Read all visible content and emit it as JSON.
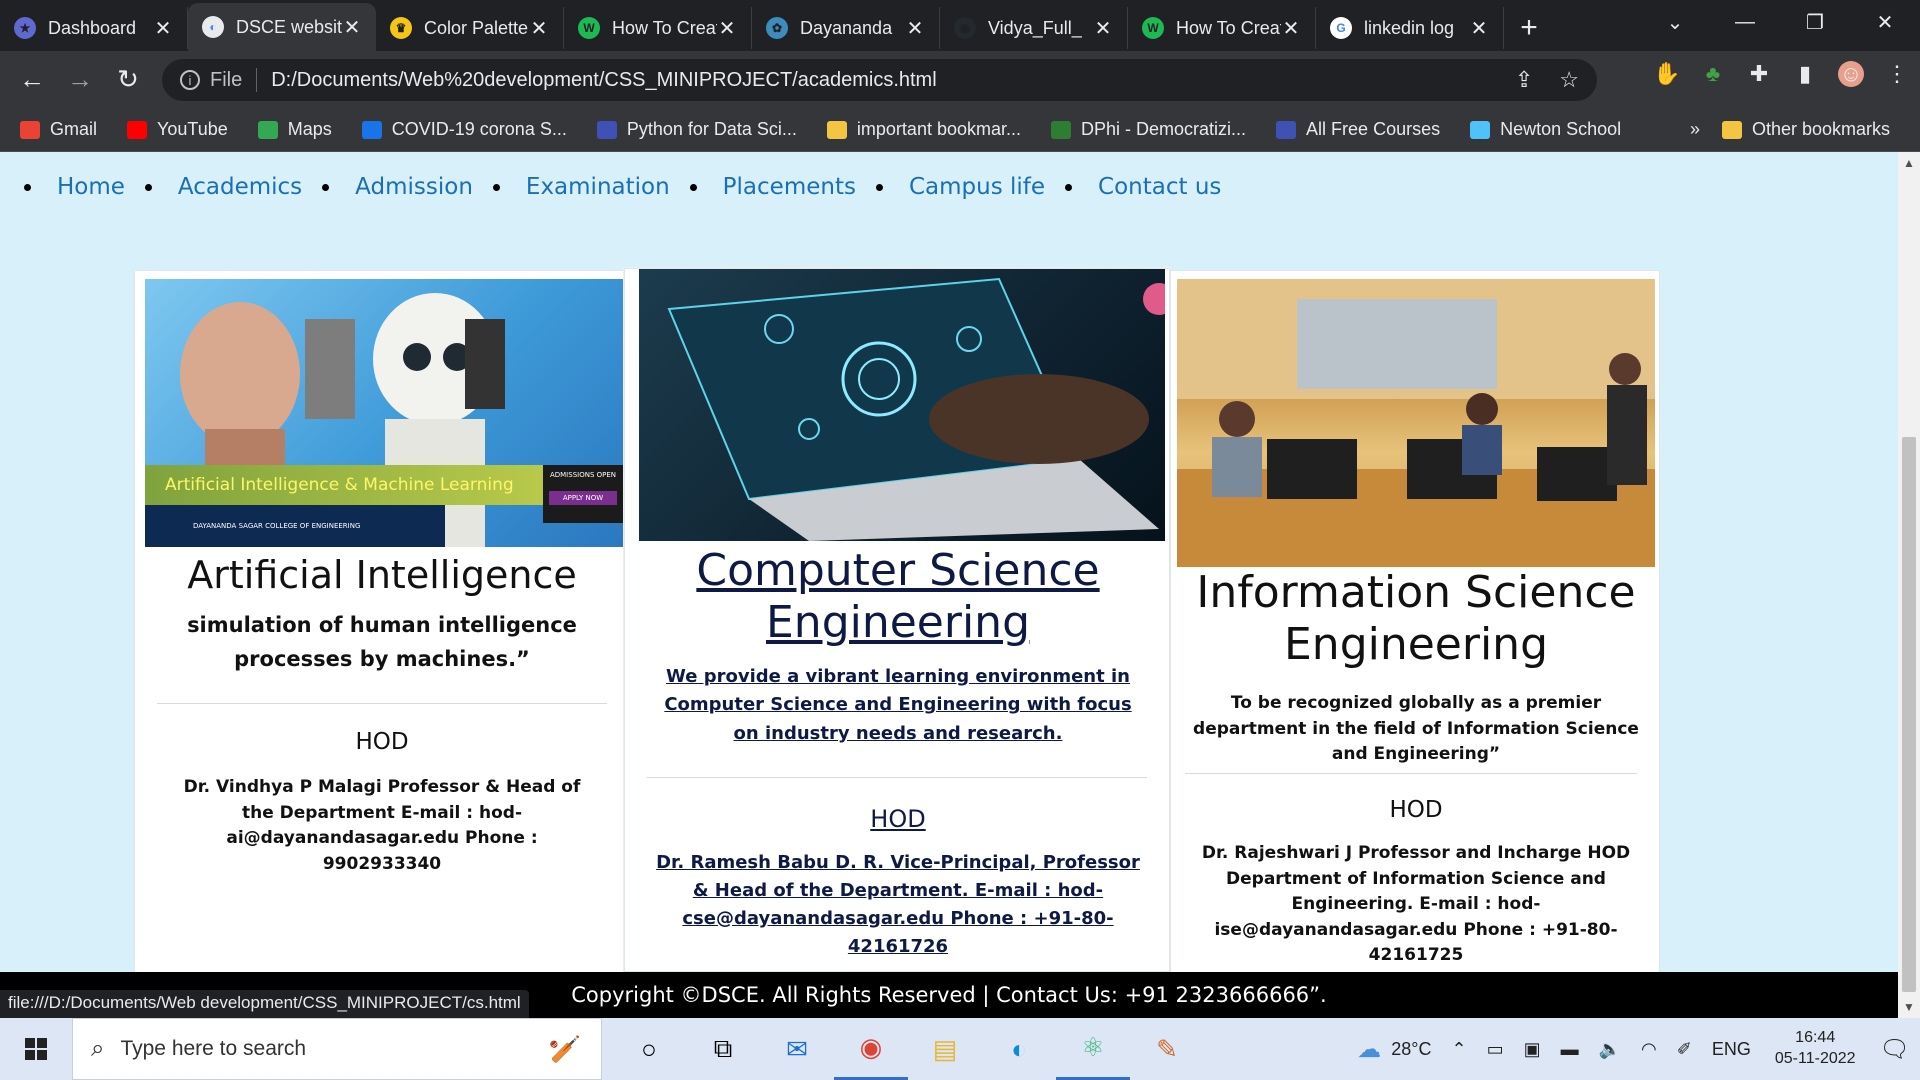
{
  "browser": {
    "tabs": [
      {
        "title": "Dashboard",
        "fav_color": "#5f6ad0",
        "fav": "★"
      },
      {
        "title": "DSCE website",
        "fav_color": "#e8eaed",
        "fav": "◐",
        "active": true
      },
      {
        "title": "Color Palette",
        "fav_color": "#f5c518",
        "fav": "♛"
      },
      {
        "title": "How To Create",
        "fav_color": "#1db954",
        "fav": "W"
      },
      {
        "title": "Dayananda",
        "fav_color": "#3c8dbc",
        "fav": "✿"
      },
      {
        "title": "Vidya_Full_",
        "fav_color": "#24292e",
        "fav": "◉"
      },
      {
        "title": "How To Create",
        "fav_color": "#1db954",
        "fav": "W"
      },
      {
        "title": "linkedin log",
        "fav_color": "#fff",
        "fav": "G"
      }
    ],
    "new_tab": "+",
    "address": {
      "scheme_label": "File",
      "url": "D:/Documents/Web%20development/CSS_MINIPROJECT/academics.html"
    },
    "bookmarks": [
      {
        "label": "Gmail",
        "color": "#ea4335"
      },
      {
        "label": "YouTube",
        "color": "#ff0000"
      },
      {
        "label": "Maps",
        "color": "#34a853"
      },
      {
        "label": "COVID-19 corona S...",
        "color": "#1a73e8"
      },
      {
        "label": "Python for Data Sci...",
        "color": "#3f51b5"
      },
      {
        "label": "important bookmar...",
        "color": "#f4c542"
      },
      {
        "label": "DPhi - Democratizi...",
        "color": "#2e7d32"
      },
      {
        "label": "All Free Courses",
        "color": "#3f51b5"
      },
      {
        "label": "Newton School",
        "color": "#4fc3f7"
      }
    ],
    "bookmarks_more": "»",
    "other_bookmarks": "Other bookmarks",
    "status_url": "file:///D:/Documents/Web development/CSS_MINIPROJECT/cs.html"
  },
  "nav": [
    "Home",
    "Academics",
    "Admission",
    "Examination",
    "Placements",
    "Campus life",
    "Contact us"
  ],
  "cards": {
    "ai": {
      "title": "Artificial Intelligence",
      "desc": "simulation of human intelligence processes by machines.”",
      "hod_label": "HOD",
      "hod_info": "Dr. Vindhya P Malagi Professor & Head of the Department E-mail : hod-ai@dayanandasagar.edu Phone : 9902933340",
      "banner_text": "Artificial Intelligence & Machine Learning",
      "banner_badge_1": "ADMISSIONS OPEN",
      "banner_badge_2": "APPLY NOW",
      "banner_college": "DAYANANDA SAGAR COLLEGE OF ENGINEERING"
    },
    "cse": {
      "title": "Computer Science Engineering",
      "desc": "We provide a vibrant learning environment in Computer Science and Engineering with focus on industry needs and research.",
      "hod_label": "HOD",
      "hod_info": "Dr. Ramesh Babu D. R. Vice-Principal, Professor & Head of the Department. E-mail : hod-cse@dayanandasagar.edu Phone : +91-80-42161726"
    },
    "ise": {
      "title": "Information Science Engineering",
      "desc": "To be recognized globally as a premier department in the field of Information Science and Engineering”",
      "hod_label": "HOD",
      "hod_info": "Dr. Rajeshwari J Professor and Incharge HOD Department of Information Science and Engineering. E-mail : hod-ise@dayanandasagar.edu Phone : +91-80-42161725"
    }
  },
  "footer": "Copyright ©DSCE. All Rights Reserved | Contact Us: +91 2323666666”.",
  "taskbar": {
    "search_placeholder": "Type here to search",
    "weather": "28°C",
    "lang": "ENG",
    "time": "16:44",
    "date": "05-11-2022"
  }
}
